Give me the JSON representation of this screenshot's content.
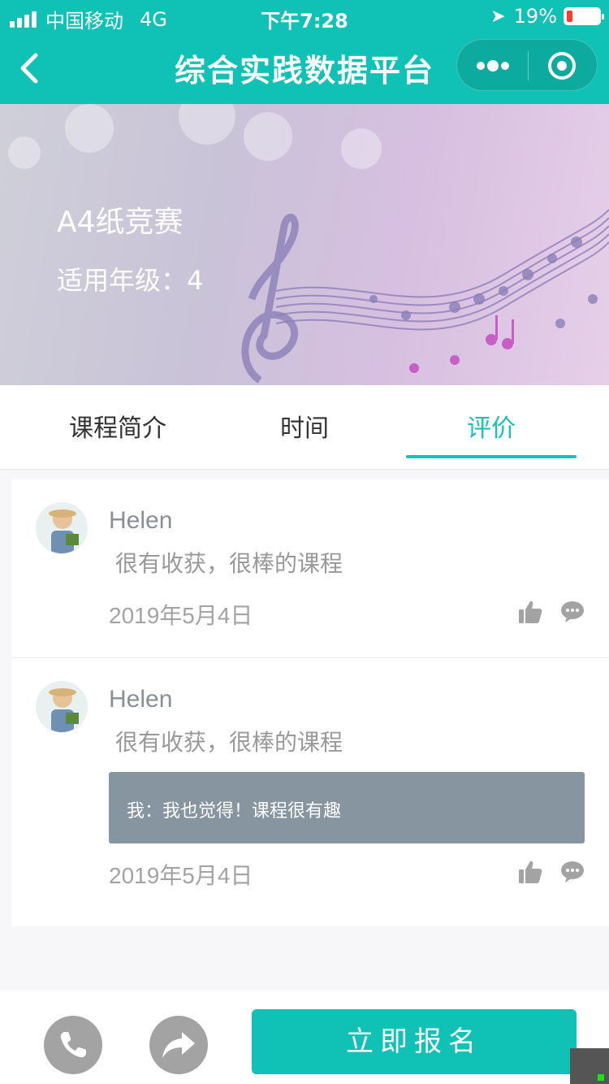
{
  "status_bar": {
    "carrier": "中国移动",
    "network": "4G",
    "time": "下午7:28",
    "battery": "19%"
  },
  "nav": {
    "title": "综合实践数据平台"
  },
  "banner": {
    "course_title": "A4纸竞赛",
    "grade_text": "适用年级：4"
  },
  "tabs": [
    {
      "label": "课程简介",
      "active": false
    },
    {
      "label": "时间",
      "active": false
    },
    {
      "label": "评价",
      "active": true
    }
  ],
  "comments": [
    {
      "name": "Helen",
      "text": "很有收获，很棒的课程",
      "date": "2019年5月4日"
    },
    {
      "name": "Helen",
      "text": "很有收获，很棒的课程",
      "reply": "我：我也觉得！课程很有趣",
      "date": "2019年5月4日"
    }
  ],
  "bottom_bar": {
    "signup_label": "立即报名"
  },
  "colors": {
    "accent": "#0fc2b5",
    "reply_bg": "#8795a0",
    "icon_gray": "#a3a3a3"
  }
}
